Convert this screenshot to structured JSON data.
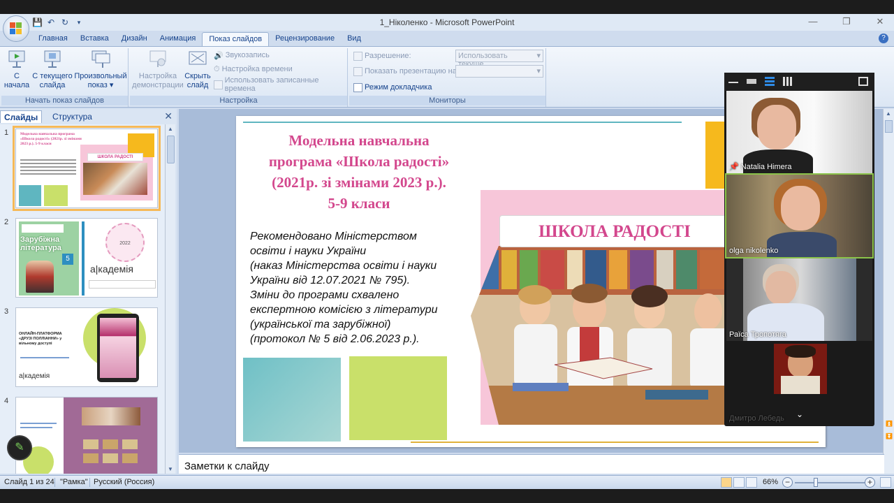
{
  "window": {
    "title": "1_Ніколенко - Microsoft PowerPoint"
  },
  "ribbon": {
    "tabs": [
      "Главная",
      "Вставка",
      "Дизайн",
      "Анимация",
      "Показ слайдов",
      "Рецензирование",
      "Вид"
    ],
    "active_tab": "Показ слайдов",
    "start_group": {
      "label": "Начать показ слайдов",
      "from_start": [
        "С",
        "начала"
      ],
      "from_current": [
        "С текущего",
        "слайда"
      ],
      "custom_show": [
        "Произвольный",
        "показ ▾"
      ]
    },
    "setup_group": {
      "label": "Настройка",
      "setup_show": [
        "Настройка",
        "демонстрации"
      ],
      "hide_slide": [
        "Скрыть",
        "слайд"
      ],
      "record_narration": "Звукозапись",
      "rehearse_timings": "Настройка времени",
      "use_timings": "Использовать записанные времена"
    },
    "monitors_group": {
      "label": "Мониторы",
      "resolution_label": "Разрешение:",
      "resolution_value": "Использовать текуще...",
      "show_on_label": "Показать презентацию на:",
      "presenter_view": "Режим докладчика"
    }
  },
  "left_pane": {
    "tabs": [
      "Слайды",
      "Структура"
    ],
    "active_tab": "Слайды",
    "slides": [
      {
        "number": "1"
      },
      {
        "number": "2"
      },
      {
        "number": "3"
      },
      {
        "number": "4"
      }
    ],
    "thumb1": {
      "title": "Модельна навчальна програма «Школа радості» (2021р. зі змінами 2023 р.). 5-9 класи",
      "school": "ШКОЛА РАДОСТІ"
    },
    "thumb2": {
      "book": "Зарубіжна література",
      "grade": "5",
      "brand": "а|кадемія",
      "year": "2022"
    },
    "thumb3": {
      "heading": "ОНЛАЙН-ПЛАТФОРМА «ДРУЗІ ПОЛЛІАННИ» у вільному доступі",
      "brand": "а|кадемія"
    }
  },
  "slide": {
    "title_lines": [
      "Модельна навчальна",
      "програма «Школа радості»",
      "(2021р. зі змінами 2023 р.).",
      "5-9 класи"
    ],
    "body_lines": [
      "Рекомендовано Міністерством",
      "освіти і науки України",
      "(наказ Міністерства освіти і науки",
      "України від 12.07.2021 № 795).",
      "Зміни до програми схвалено",
      "експертною комісією з літератури",
      "(української та зарубіжної)",
      "(протокол № 5 від 2.06.2023 р.)."
    ],
    "school_label": "ШКОЛА РАДОСТІ"
  },
  "notes": {
    "placeholder": "Заметки к слайду"
  },
  "status": {
    "slide_counter": "Слайд 1 из 24",
    "theme": "\"Рамка\"",
    "language": "Русский (Россия)",
    "zoom": "66%"
  },
  "zoom_panel": {
    "participants": [
      {
        "name": "Natalia Himera"
      },
      {
        "name": "olga nikolenko"
      },
      {
        "name": "Раїса Тропотяга"
      },
      {
        "name": "Дмитро Лебедь"
      }
    ]
  },
  "colors": {
    "accent_pink": "#d3478d",
    "ribbon_blue": "#15428b",
    "slide_teal": "#5fb6c0",
    "slide_green": "#c9e06a",
    "slide_orange": "#f6b91d",
    "zoom_active": "#8bc34a"
  }
}
